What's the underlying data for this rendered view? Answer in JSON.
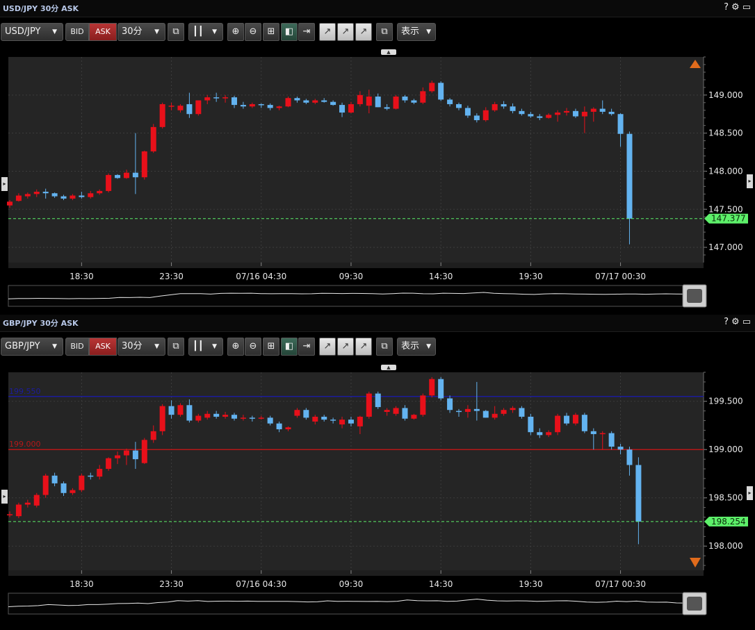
{
  "colors": {
    "up": "#e8101a",
    "down": "#63b3f0",
    "bg": "#252525",
    "grid": "#3d3d3d",
    "price_tag": "#5df06a",
    "line_blue": "#1c1c9c",
    "line_red": "#b51818"
  },
  "toolbar": {
    "bid_label": "BID",
    "ask_label": "ASK",
    "timeframe": "30分",
    "display_label": "表示"
  },
  "panels": [
    {
      "title": "USD/JPY 30分 ASK",
      "symbol": "USD/JPY"
    },
    {
      "title": "GBP/JPY 30分 ASK",
      "symbol": "GBP/JPY"
    }
  ],
  "chart_data": [
    {
      "type": "candlestick",
      "ylim": [
        146.8,
        149.5
      ],
      "y_ticks": [
        147.0,
        147.5,
        148.0,
        148.5,
        149.0
      ],
      "y_tick_labels": [
        "147.000",
        "147.500",
        "148.000",
        "148.500",
        "149.000"
      ],
      "x_tick_labels": [
        "18:30",
        "23:30",
        "07/16 04:30",
        "09:30",
        "14:30",
        "19:30",
        "07/17 00:30"
      ],
      "x_tick_index": [
        8,
        18,
        28,
        38,
        48,
        58,
        68
      ],
      "current_price": 147.377,
      "current_price_label": "147.377",
      "candles": [
        [
          147.55,
          147.62,
          147.52,
          147.6
        ],
        [
          147.61,
          147.71,
          147.6,
          147.68
        ],
        [
          147.67,
          147.72,
          147.64,
          147.7
        ],
        [
          147.7,
          147.76,
          147.66,
          147.73
        ],
        [
          147.73,
          147.77,
          147.64,
          147.71
        ],
        [
          147.71,
          147.72,
          147.65,
          147.67
        ],
        [
          147.67,
          147.69,
          147.62,
          147.64
        ],
        [
          147.64,
          147.7,
          147.62,
          147.68
        ],
        [
          147.68,
          147.73,
          147.64,
          147.66
        ],
        [
          147.66,
          147.74,
          147.64,
          147.71
        ],
        [
          147.71,
          147.76,
          147.69,
          147.74
        ],
        [
          147.74,
          147.97,
          147.72,
          147.95
        ],
        [
          147.95,
          147.96,
          147.9,
          147.91
        ],
        [
          147.91,
          148.02,
          147.9,
          147.98
        ],
        [
          147.98,
          148.5,
          147.7,
          147.92
        ],
        [
          147.92,
          148.27,
          147.89,
          148.26
        ],
        [
          148.26,
          148.62,
          148.24,
          148.58
        ],
        [
          148.58,
          148.9,
          148.56,
          148.88
        ],
        [
          148.85,
          148.9,
          148.8,
          148.86
        ],
        [
          148.8,
          148.88,
          148.77,
          148.86
        ],
        [
          148.88,
          149.03,
          148.7,
          148.75
        ],
        [
          148.75,
          148.93,
          148.73,
          148.93
        ],
        [
          148.93,
          149.0,
          148.88,
          148.97
        ],
        [
          148.97,
          149.03,
          148.91,
          148.96
        ],
        [
          148.96,
          149.0,
          148.9,
          148.97
        ],
        [
          148.97,
          148.99,
          148.83,
          148.87
        ],
        [
          148.87,
          148.91,
          148.82,
          148.85
        ],
        [
          148.85,
          148.9,
          148.83,
          148.88
        ],
        [
          148.88,
          148.89,
          148.83,
          148.87
        ],
        [
          148.87,
          148.89,
          148.8,
          148.83
        ],
        [
          148.83,
          148.86,
          148.8,
          148.85
        ],
        [
          148.85,
          148.98,
          148.84,
          148.96
        ],
        [
          148.96,
          148.98,
          148.9,
          148.93
        ],
        [
          148.93,
          148.95,
          148.88,
          148.9
        ],
        [
          148.9,
          148.95,
          148.88,
          148.93
        ],
        [
          148.93,
          148.96,
          148.9,
          148.91
        ],
        [
          148.91,
          148.93,
          148.86,
          148.87
        ],
        [
          148.87,
          148.9,
          148.71,
          148.77
        ],
        [
          148.77,
          148.91,
          148.76,
          148.88
        ],
        [
          148.88,
          149.05,
          148.85,
          149.0
        ],
        [
          148.86,
          149.07,
          148.76,
          148.98
        ],
        [
          148.98,
          149.02,
          148.84,
          148.84
        ],
        [
          148.84,
          148.88,
          148.8,
          148.82
        ],
        [
          148.82,
          149.0,
          148.81,
          148.98
        ],
        [
          148.98,
          149.0,
          148.9,
          148.93
        ],
        [
          148.93,
          148.95,
          148.88,
          148.9
        ],
        [
          148.9,
          149.1,
          148.88,
          149.05
        ],
        [
          149.05,
          149.19,
          149.03,
          149.16
        ],
        [
          149.16,
          149.18,
          148.92,
          148.94
        ],
        [
          148.94,
          148.96,
          148.85,
          148.88
        ],
        [
          148.88,
          148.9,
          148.8,
          148.83
        ],
        [
          148.83,
          148.86,
          148.7,
          148.73
        ],
        [
          148.73,
          148.76,
          148.64,
          148.67
        ],
        [
          148.67,
          148.84,
          148.65,
          148.8
        ],
        [
          148.8,
          148.91,
          148.78,
          148.88
        ],
        [
          148.88,
          148.92,
          148.82,
          148.85
        ],
        [
          148.85,
          148.89,
          148.76,
          148.79
        ],
        [
          148.79,
          148.82,
          148.73,
          148.75
        ],
        [
          148.75,
          148.78,
          148.7,
          148.72
        ],
        [
          148.72,
          148.75,
          148.67,
          148.7
        ],
        [
          148.7,
          148.76,
          148.69,
          148.74
        ],
        [
          148.74,
          148.8,
          148.65,
          148.77
        ],
        [
          148.77,
          148.83,
          148.73,
          148.79
        ],
        [
          148.79,
          148.82,
          148.7,
          148.72
        ],
        [
          148.72,
          148.85,
          148.5,
          148.78
        ],
        [
          148.78,
          148.84,
          148.65,
          148.82
        ],
        [
          148.82,
          148.93,
          148.75,
          148.78
        ],
        [
          148.78,
          148.82,
          148.73,
          148.75
        ],
        [
          148.75,
          148.76,
          148.32,
          148.49
        ],
        [
          148.49,
          148.52,
          147.04,
          147.377
        ]
      ]
    },
    {
      "type": "candlestick",
      "ylim": [
        197.75,
        199.8
      ],
      "y_ticks": [
        198.0,
        198.5,
        199.0,
        199.5
      ],
      "y_tick_labels": [
        "198.000",
        "198.500",
        "199.000",
        "199.500"
      ],
      "x_tick_labels": [
        "18:30",
        "23:30",
        "07/16 04:30",
        "09:30",
        "14:30",
        "19:30",
        "07/17 00:30"
      ],
      "x_tick_index": [
        8,
        18,
        28,
        38,
        48,
        58,
        68
      ],
      "current_price": 198.254,
      "current_price_label": "198.254",
      "hlines": [
        {
          "value": 199.55,
          "label": "199.550",
          "color": "blue"
        },
        {
          "value": 199.0,
          "label": "199.000",
          "color": "red"
        }
      ],
      "candles": [
        [
          198.33,
          198.36,
          198.3,
          198.33
        ],
        [
          198.31,
          198.45,
          198.29,
          198.43
        ],
        [
          198.43,
          198.48,
          198.4,
          198.45
        ],
        [
          198.42,
          198.55,
          198.4,
          198.53
        ],
        [
          198.53,
          198.75,
          198.5,
          198.73
        ],
        [
          198.73,
          198.76,
          198.62,
          198.65
        ],
        [
          198.65,
          198.67,
          198.52,
          198.55
        ],
        [
          198.55,
          198.6,
          198.53,
          198.58
        ],
        [
          198.58,
          198.75,
          198.56,
          198.73
        ],
        [
          198.73,
          198.76,
          198.69,
          198.72
        ],
        [
          198.72,
          198.84,
          198.69,
          198.8
        ],
        [
          198.8,
          198.92,
          198.78,
          198.91
        ],
        [
          198.91,
          198.98,
          198.85,
          198.94
        ],
        [
          198.94,
          199.01,
          198.84,
          198.99
        ],
        [
          198.99,
          199.08,
          198.8,
          198.9
        ],
        [
          198.86,
          199.12,
          198.85,
          199.1
        ],
        [
          199.1,
          199.25,
          199.07,
          199.19
        ],
        [
          199.19,
          199.47,
          199.15,
          199.45
        ],
        [
          199.45,
          199.51,
          199.32,
          199.36
        ],
        [
          199.36,
          199.48,
          199.34,
          199.46
        ],
        [
          199.46,
          199.52,
          199.28,
          199.3
        ],
        [
          199.3,
          199.37,
          199.28,
          199.35
        ],
        [
          199.33,
          199.4,
          199.31,
          199.37
        ],
        [
          199.37,
          199.4,
          199.32,
          199.34
        ],
        [
          199.34,
          199.39,
          199.32,
          199.36
        ],
        [
          199.36,
          199.38,
          199.3,
          199.32
        ],
        [
          199.32,
          199.36,
          199.3,
          199.33
        ],
        [
          199.33,
          199.35,
          199.29,
          199.32
        ],
        [
          199.32,
          199.35,
          199.31,
          199.33
        ],
        [
          199.33,
          199.35,
          199.25,
          199.27
        ],
        [
          199.27,
          199.29,
          199.18,
          199.21
        ],
        [
          199.21,
          199.24,
          199.19,
          199.23
        ],
        [
          199.35,
          199.43,
          199.33,
          199.41
        ],
        [
          199.41,
          199.43,
          199.31,
          199.33
        ],
        [
          199.29,
          199.36,
          199.26,
          199.34
        ],
        [
          199.34,
          199.36,
          199.29,
          199.31
        ],
        [
          199.31,
          199.33,
          199.27,
          199.3
        ],
        [
          199.26,
          199.34,
          199.22,
          199.31
        ],
        [
          199.31,
          199.34,
          199.24,
          199.27
        ],
        [
          199.24,
          199.35,
          199.16,
          199.34
        ],
        [
          199.34,
          199.6,
          199.32,
          199.58
        ],
        [
          199.58,
          199.6,
          199.42,
          199.44
        ],
        [
          199.39,
          199.43,
          199.35,
          199.41
        ],
        [
          199.37,
          199.45,
          199.35,
          199.43
        ],
        [
          199.43,
          199.46,
          199.3,
          199.32
        ],
        [
          199.32,
          199.37,
          199.31,
          199.36
        ],
        [
          199.36,
          199.58,
          199.34,
          199.56
        ],
        [
          199.56,
          199.75,
          199.54,
          199.73
        ],
        [
          199.73,
          199.75,
          199.51,
          199.53
        ],
        [
          199.53,
          199.56,
          199.38,
          199.41
        ],
        [
          199.4,
          199.42,
          199.34,
          199.39
        ],
        [
          199.39,
          199.46,
          199.33,
          199.42
        ],
        [
          199.42,
          199.7,
          199.3,
          199.4
        ],
        [
          199.4,
          199.41,
          199.33,
          199.33
        ],
        [
          199.33,
          199.45,
          199.31,
          199.37
        ],
        [
          199.37,
          199.43,
          199.35,
          199.41
        ],
        [
          199.41,
          199.45,
          199.38,
          199.43
        ],
        [
          199.43,
          199.45,
          199.32,
          199.34
        ],
        [
          199.34,
          199.37,
          199.15,
          199.18
        ],
        [
          199.18,
          199.22,
          199.12,
          199.15
        ],
        [
          199.15,
          199.2,
          199.13,
          199.18
        ],
        [
          199.18,
          199.37,
          199.15,
          199.35
        ],
        [
          199.35,
          199.38,
          199.25,
          199.27
        ],
        [
          199.27,
          199.38,
          199.25,
          199.36
        ],
        [
          199.36,
          199.38,
          199.17,
          199.19
        ],
        [
          199.19,
          199.22,
          199.0,
          199.16
        ],
        [
          199.16,
          199.19,
          199.0,
          199.17
        ],
        [
          199.17,
          199.19,
          199.0,
          199.03
        ],
        [
          199.03,
          199.06,
          198.95,
          199.0
        ],
        [
          199.0,
          199.03,
          198.73,
          198.84
        ],
        [
          198.84,
          198.92,
          198.02,
          198.254
        ]
      ]
    }
  ]
}
